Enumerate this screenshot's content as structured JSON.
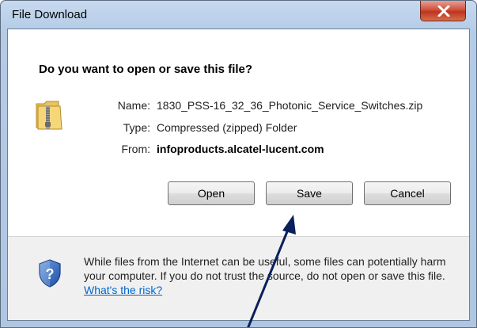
{
  "window": {
    "title": "File Download",
    "close_label": "X"
  },
  "dialog": {
    "question": "Do you want to open or save this file?",
    "file": {
      "name_label": "Name:",
      "name_value": "1830_PSS-16_32_36_Photonic_Service_Switches.zip",
      "type_label": "Type:",
      "type_value": "Compressed (zipped) Folder",
      "from_label": "From:",
      "from_value": "infoproducts.alcatel-lucent.com"
    },
    "buttons": {
      "open": "Open",
      "save": "Save",
      "cancel": "Cancel"
    },
    "warning": {
      "text": "While files from the Internet can be useful, some files can potentially harm your computer. If you do not trust the source, do not open or save this file. ",
      "link": "What's the risk?"
    }
  },
  "icons": {
    "file_icon": "zip-folder-icon",
    "warning_icon": "shield-question-icon",
    "annotation": "arrow-annotation"
  },
  "colors": {
    "titlebar": "#b4cbe6",
    "close_button": "#c8412b",
    "link": "#0066cc",
    "arrow": "#0b1f5c"
  }
}
